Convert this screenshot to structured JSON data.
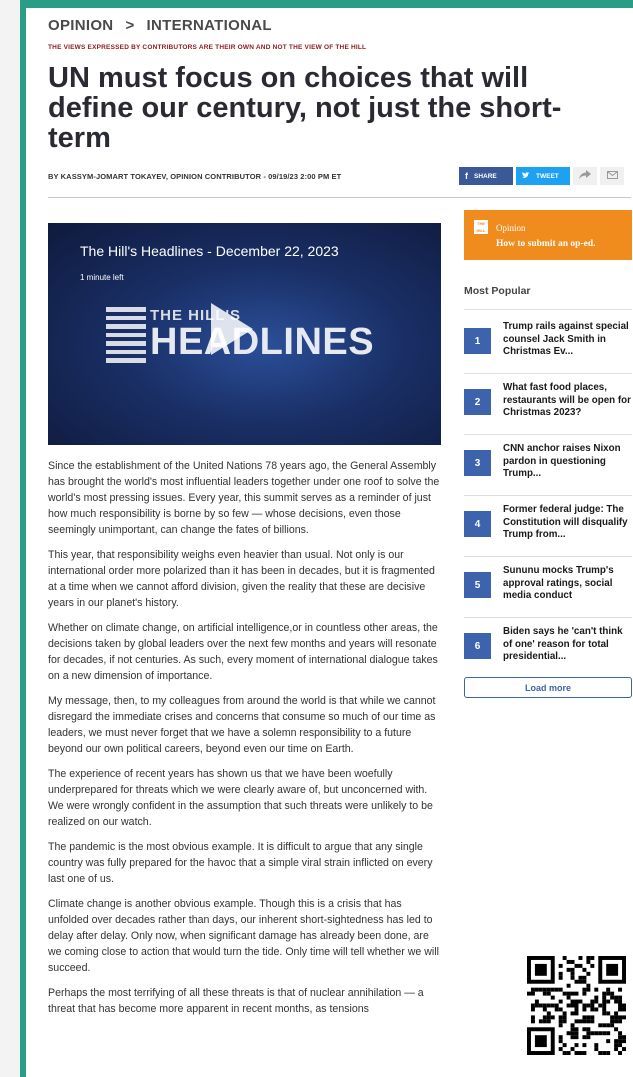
{
  "breadcrumb": {
    "section": "OPINION",
    "separator": ">",
    "subsection": "INTERNATIONAL"
  },
  "disclaimer": "THE VIEWS EXPRESSED BY CONTRIBUTORS ARE THEIR OWN AND NOT THE VIEW OF THE HILL",
  "headline": "UN must focus on choices that will define our century, not just the short-term",
  "byline": "BY KASSYM-JOMART TOKAYEV, OPINION CONTRIBUTOR - 09/19/23 2:00 PM ET",
  "share": {
    "facebook_label": "SHARE",
    "twitter_label": "TWEET",
    "facebook_icon": "f",
    "twitter_icon": "t",
    "forward_icon": "share-arrow-icon",
    "email_icon": "envelope-icon"
  },
  "video": {
    "title": "The Hill's Headlines - December 22, 2023",
    "time_left": "1 minute left",
    "logo_top": "THE HILL'S",
    "logo_main": "HEADLINES"
  },
  "article": {
    "paragraphs": [
      "Since the establishment of the United Nations 78 years ago, the General Assembly has brought the world's most influential leaders together under one roof to solve the world's most pressing issues. Every year, this summit serves as a reminder of just how much responsibility is borne by so few — whose decisions, even those seemingly unimportant, can change the fates of billions.",
      "This year, that responsibility weighs even heavier than usual. Not only is our international order more polarized than it has been in decades, but it is fragmented at a time when we cannot afford division, given the reality that these are decisive years in our planet's history.",
      "Whether on climate change, on artificial intelligence,or in countless other areas, the decisions taken by global leaders over the next few months and years will resonate for decades, if not centuries. As such, every moment of international dialogue takes on a new dimension of importance.",
      "My message, then, to my colleagues from around the world is that while we cannot disregard the immediate crises and concerns that consume so much of our time as leaders, we must never forget that we have a solemn responsibility to a future beyond our own political careers, beyond even our time on Earth.",
      "The experience of recent years has shown us that we have been woefully underprepared for threats which we were clearly aware of, but unconcerned with. We were wrongly confident in the assumption that such threats were unlikely to be realized on our watch.",
      "The pandemic is the most obvious example. It is difficult to argue that any single country was fully prepared for the havoc that a simple viral strain inflicted on every last one of us.",
      "Climate change is another obvious example. Though this is a crisis that has unfolded over decades rather than days, our inherent short-sightedness has led to delay after delay. Only now, when significant damage has already been done, are we coming close to action that would turn the tide. Only time will tell whether we will succeed.",
      "Perhaps the most terrifying of all these threats is that of nuclear annihilation — a threat that has become more apparent in recent months, as tensions"
    ]
  },
  "promo": {
    "badge": "THE HILL",
    "top": "Opinion",
    "bottom": "How to submit an op-ed."
  },
  "most_popular": {
    "heading": "Most Popular",
    "items": [
      {
        "num": "1",
        "text": "Trump rails against special counsel Jack Smith in Christmas Ev..."
      },
      {
        "num": "2",
        "text": "What fast food places, restaurants will be open for Christmas 2023?"
      },
      {
        "num": "3",
        "text": "CNN anchor raises Nixon pardon in questioning Trump..."
      },
      {
        "num": "4",
        "text": "Former federal judge: The Constitution will disqualify Trump from..."
      },
      {
        "num": "5",
        "text": "Sununu mocks Trump's approval ratings, social media conduct"
      },
      {
        "num": "6",
        "text": "Biden says he 'can't think of one' reason for total presidential..."
      }
    ],
    "load_more": "Load more"
  },
  "colors": {
    "frame": "#2a9d86",
    "accent_blue": "#3e63ad",
    "promo_orange": "#f08c1e",
    "disclaimer_red": "#8b1a1a"
  }
}
